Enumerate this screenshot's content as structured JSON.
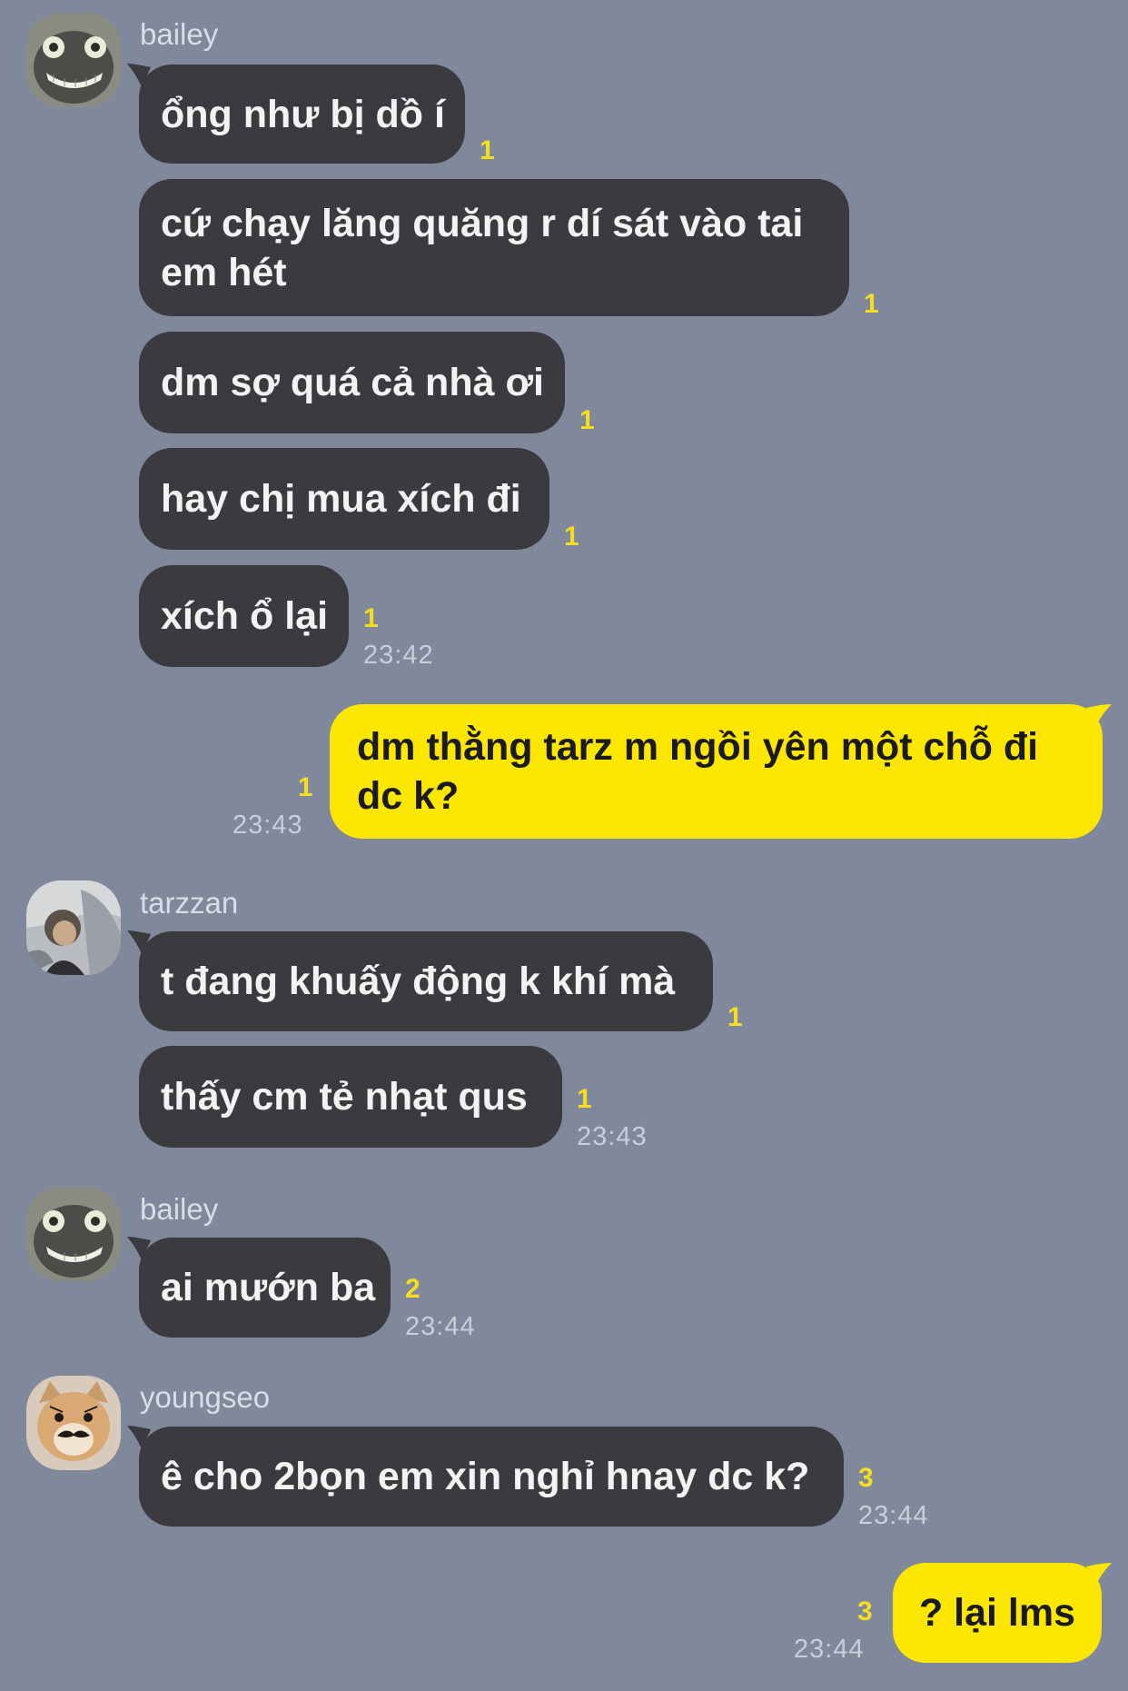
{
  "colors": {
    "background": "#7f899b",
    "incoming_bubble": "#3a3a3f",
    "outgoing_bubble": "#fde700",
    "unread_count": "#f5dd22",
    "timestamp": "#c9ced8"
  },
  "groups": [
    {
      "sender": "bailey",
      "avatar_icon": "frog-face-avatar-icon",
      "messages": [
        {
          "lines": [
            "ổng như bị dồ í"
          ],
          "count": "1"
        },
        {
          "lines": [
            "cứ chạy lăng quăng r dí sát vào tai",
            "em hét"
          ],
          "count": "1"
        },
        {
          "lines": [
            "dm sợ quá cả nhà ơi"
          ],
          "count": "1"
        },
        {
          "lines": [
            "hay chị mua xích đi"
          ],
          "count": "1"
        },
        {
          "lines": [
            "xích ổ lại"
          ],
          "count": "1",
          "time": "23:42"
        }
      ]
    },
    {
      "sender": "me",
      "messages": [
        {
          "lines": [
            "dm thằng tarz m ngồi yên một chỗ đi",
            "dc k?"
          ],
          "count": "1",
          "time": "23:43"
        }
      ]
    },
    {
      "sender": "tarzzan",
      "avatar_icon": "person-photo-avatar-icon",
      "messages": [
        {
          "lines": [
            "t đang khuấy động k khí mà"
          ],
          "count": "1"
        },
        {
          "lines": [
            "thấy cm tẻ nhạt qus"
          ],
          "count": "1",
          "time": "23:43"
        }
      ]
    },
    {
      "sender": "bailey",
      "avatar_icon": "frog-face-avatar-icon",
      "messages": [
        {
          "lines": [
            "ai mướn ba"
          ],
          "count": "2",
          "time": "23:44"
        }
      ]
    },
    {
      "sender": "youngseo",
      "avatar_icon": "mustache-cat-avatar-icon",
      "messages": [
        {
          "lines": [
            "ê cho 2bọn em xin nghỉ hnay dc k?"
          ],
          "count": "3",
          "time": "23:44"
        }
      ]
    },
    {
      "sender": "me",
      "messages": [
        {
          "lines": [
            "? lại lms"
          ],
          "count": "3",
          "time": "23:44"
        }
      ]
    }
  ]
}
